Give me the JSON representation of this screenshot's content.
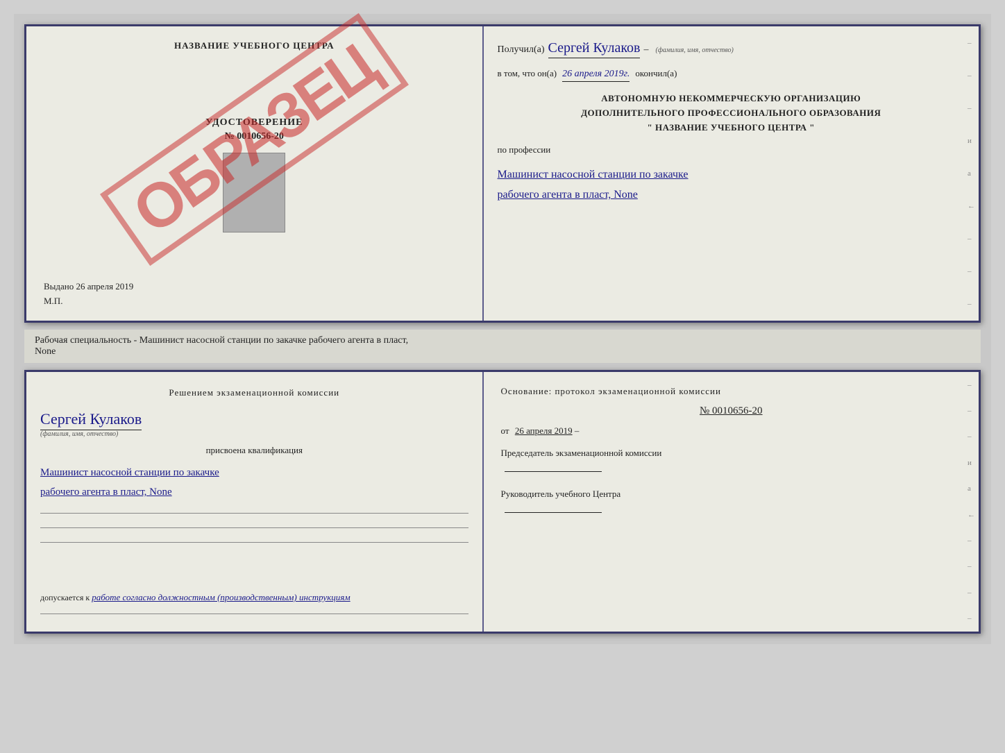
{
  "page": {
    "background": "#c8c8c8"
  },
  "cert_top": {
    "left": {
      "title": "НАЗВАНИЕ УЧЕБНОГО ЦЕНТРА",
      "stamp_text": "ОБРАЗЕЦ",
      "udostoverenie": "УДОСТОВЕРЕНИЕ",
      "number": "№ 0010656-20",
      "vydano_label": "Выдано",
      "vydano_date": "26 апреля 2019",
      "mp": "М.П."
    },
    "right": {
      "poluchil_prefix": "Получил(а)",
      "recipient_name": "Сергей Кулаков",
      "fio_label": "(фамилия, имя, отчество)",
      "vtom_prefix": "в том, что он(а)",
      "date": "26 апреля 2019г.",
      "okonchil": "окончил(а)",
      "org_line1": "АВТОНОМНУЮ НЕКОММЕРЧЕСКУЮ ОРГАНИЗАЦИЮ",
      "org_line2": "ДОПОЛНИТЕЛЬНОГО ПРОФЕССИОНАЛЬНОГО ОБРАЗОВАНИЯ",
      "org_name": "\"  НАЗВАНИЕ УЧЕБНОГО ЦЕНТРА  \"",
      "po_professii": "по профессии",
      "profession_line1": "Машинист насосной станции по закачке",
      "profession_line2": "рабочего агента в пласт, None",
      "right_marks": [
        "-",
        "-",
        "-",
        "и",
        "а",
        "←",
        "-",
        "-",
        "-"
      ]
    }
  },
  "separator": {
    "text": "Рабочая специальность - Машинист насосной станции по закачке рабочего агента в пласт,",
    "text2": "None"
  },
  "cert_bottom": {
    "left": {
      "resheniem": "Решением экзаменационной комиссии",
      "name": "Сергей Кулаков",
      "fio_label": "(фамилия, имя, отчество)",
      "prisvoena": "присвоена квалификация",
      "qualification_line1": "Машинист насосной станции по закачке",
      "qualification_line2": "рабочего агента в пласт, None",
      "dopuskaetsya": "допускается к",
      "dopusk_value": "работе согласно должностным (производственным) инструкциям"
    },
    "right": {
      "osnovanie": "Основание: протокол экзаменационной комиссии",
      "number": "№ 0010656-20",
      "ot_prefix": "от",
      "ot_date": "26 апреля 2019",
      "predsedatel_title": "Председатель экзаменационной комиссии",
      "rukovoditel_title": "Руководитель учебного Центра",
      "right_marks": [
        "-",
        "-",
        "-",
        "и",
        "а",
        "←",
        "-",
        "-",
        "-",
        "-"
      ]
    }
  }
}
